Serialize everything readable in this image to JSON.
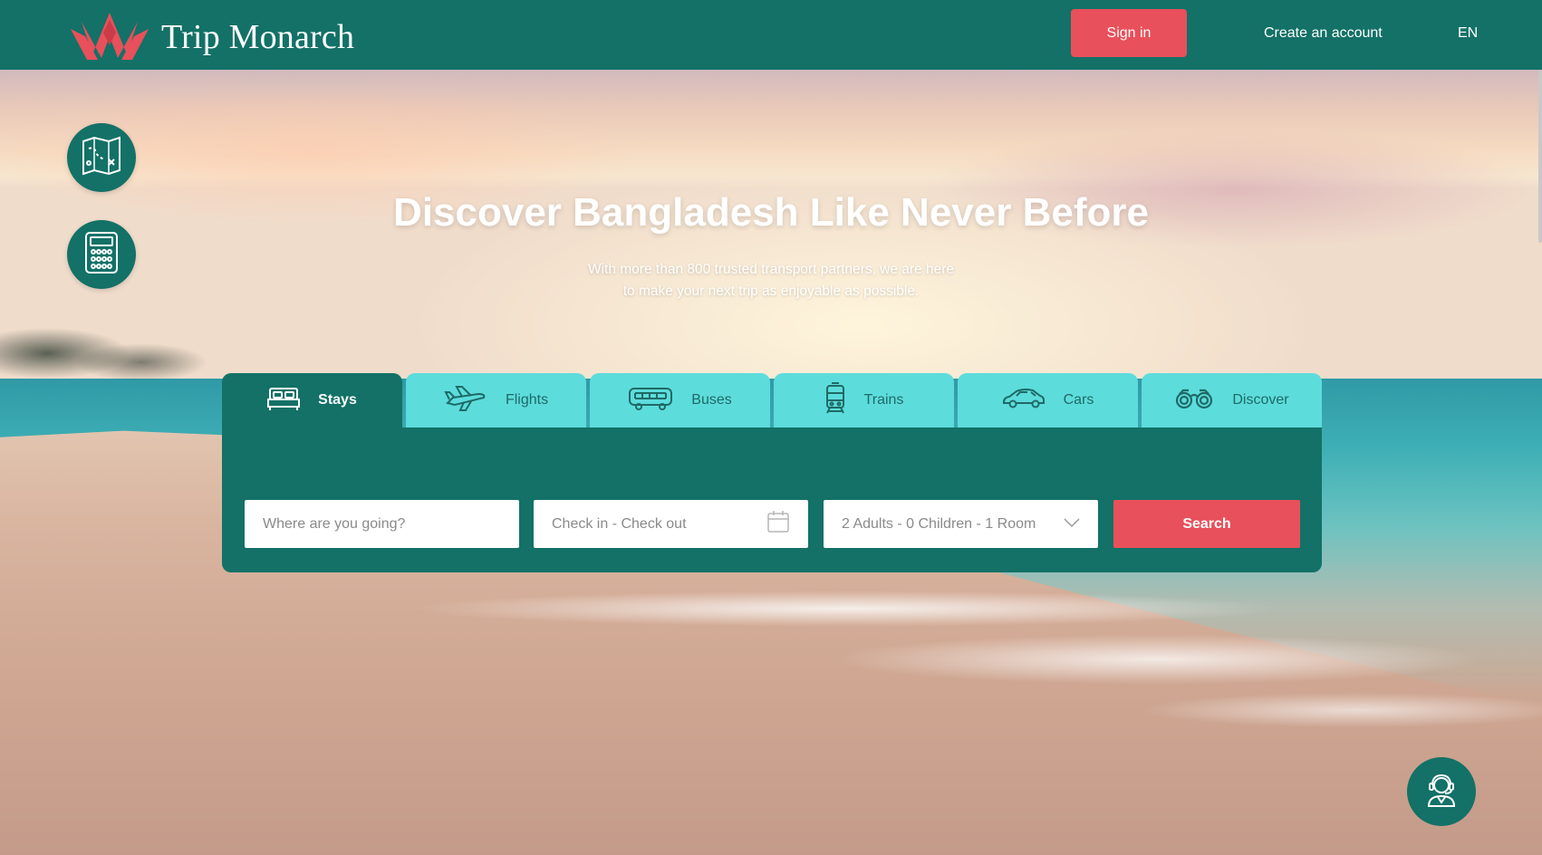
{
  "header": {
    "logo_text": "Trip Monarch",
    "signin_label": "Sign in",
    "create_account_label": "Create an account",
    "language": "EN"
  },
  "side_buttons": [
    {
      "icon": "treasure-map-icon"
    },
    {
      "icon": "calculator-icon"
    }
  ],
  "hero": {
    "title": "Discover Bangladesh Like Never Before",
    "subtitle_line1": "With more than 800 trusted transport partners, we are here",
    "subtitle_line2": "to make your next trip as enjoyable as possible."
  },
  "tabs": [
    {
      "label": "Stays",
      "icon": "bed-icon",
      "active": true
    },
    {
      "label": "Flights",
      "icon": "airplane-icon",
      "active": false
    },
    {
      "label": "Buses",
      "icon": "bus-icon",
      "active": false
    },
    {
      "label": "Trains",
      "icon": "train-icon",
      "active": false
    },
    {
      "label": "Cars",
      "icon": "car-icon",
      "active": false
    },
    {
      "label": "Discover",
      "icon": "binoculars-icon",
      "active": false
    }
  ],
  "search": {
    "destination_placeholder": "Where are you going?",
    "dates_placeholder": "Check in - Check out",
    "guests_value": "2 Adults - 0 Children - 1 Room",
    "search_label": "Search"
  },
  "support": {
    "icon": "customer-support-icon"
  },
  "colors": {
    "primary": "#137167",
    "accent": "#e8505b",
    "tab_inactive": "#5ddcdc",
    "tab_text": "#1f6a66"
  }
}
